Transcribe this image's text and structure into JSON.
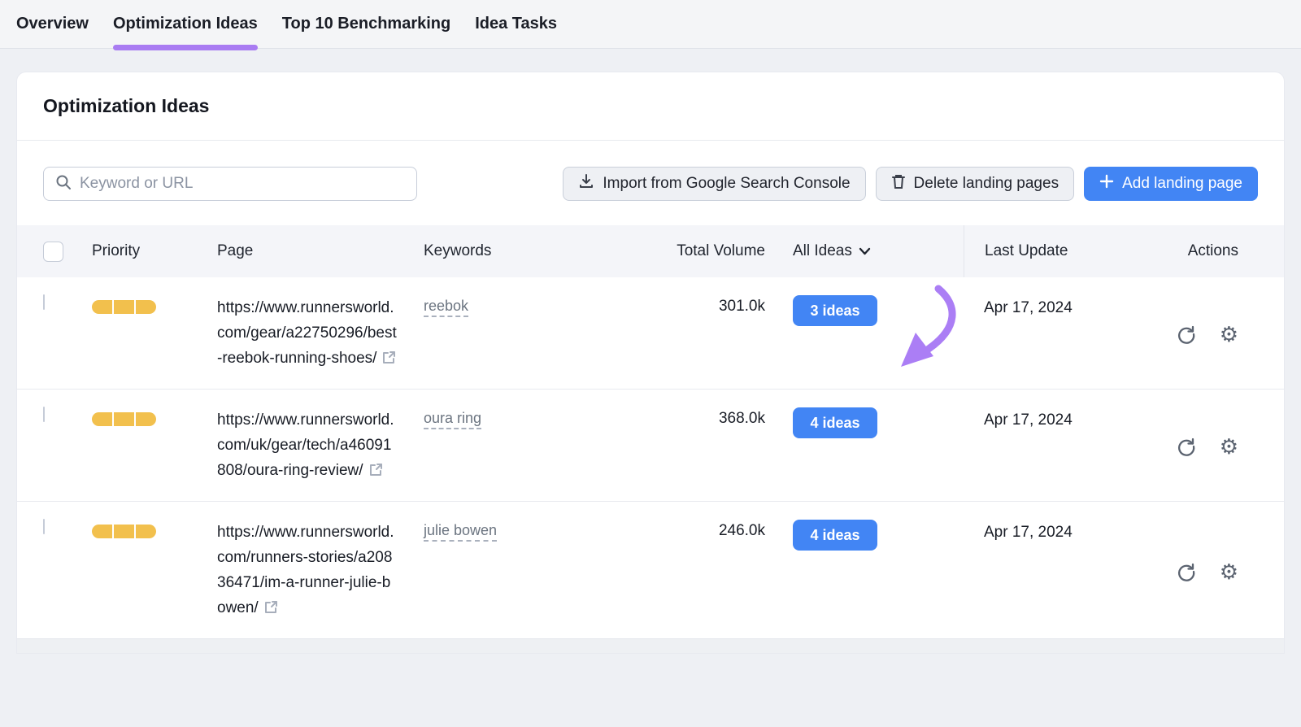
{
  "tabs": [
    {
      "label": "Overview",
      "active": false
    },
    {
      "label": "Optimization Ideas",
      "active": true
    },
    {
      "label": "Top 10 Benchmarking",
      "active": false
    },
    {
      "label": "Idea Tasks",
      "active": false
    }
  ],
  "card": {
    "title": "Optimization Ideas"
  },
  "toolbar": {
    "search_placeholder": "Keyword or URL",
    "import_label": "Import from Google Search Console",
    "delete_label": "Delete landing pages",
    "add_label": "Add landing page"
  },
  "table": {
    "headers": {
      "priority": "Priority",
      "page": "Page",
      "keywords": "Keywords",
      "volume": "Total Volume",
      "ideas": "All Ideas",
      "last_update": "Last Update",
      "actions": "Actions"
    },
    "rows": [
      {
        "url": "https://www.runnersworld.com/gear/a22750296/best-reebok-running-shoes/",
        "keyword": "reebok",
        "volume": "301.0k",
        "ideas": "3 ideas",
        "date": "Apr 17, 2024"
      },
      {
        "url": "https://www.runnersworld.com/uk/gear/tech/a46091808/oura-ring-review/",
        "keyword": "oura ring",
        "volume": "368.0k",
        "ideas": "4 ideas",
        "date": "Apr 17, 2024"
      },
      {
        "url": "https://www.runnersworld.com/runners-stories/a20836471/im-a-runner-julie-bowen/",
        "keyword": "julie bowen",
        "volume": "246.0k",
        "ideas": "4 ideas",
        "date": "Apr 17, 2024"
      }
    ]
  },
  "colors": {
    "accent_blue": "#4285f4",
    "tab_underline_purple": "#a97cf2",
    "annotation_purple": "#ab7ef5",
    "priority_yellow": "#f2c04d"
  }
}
